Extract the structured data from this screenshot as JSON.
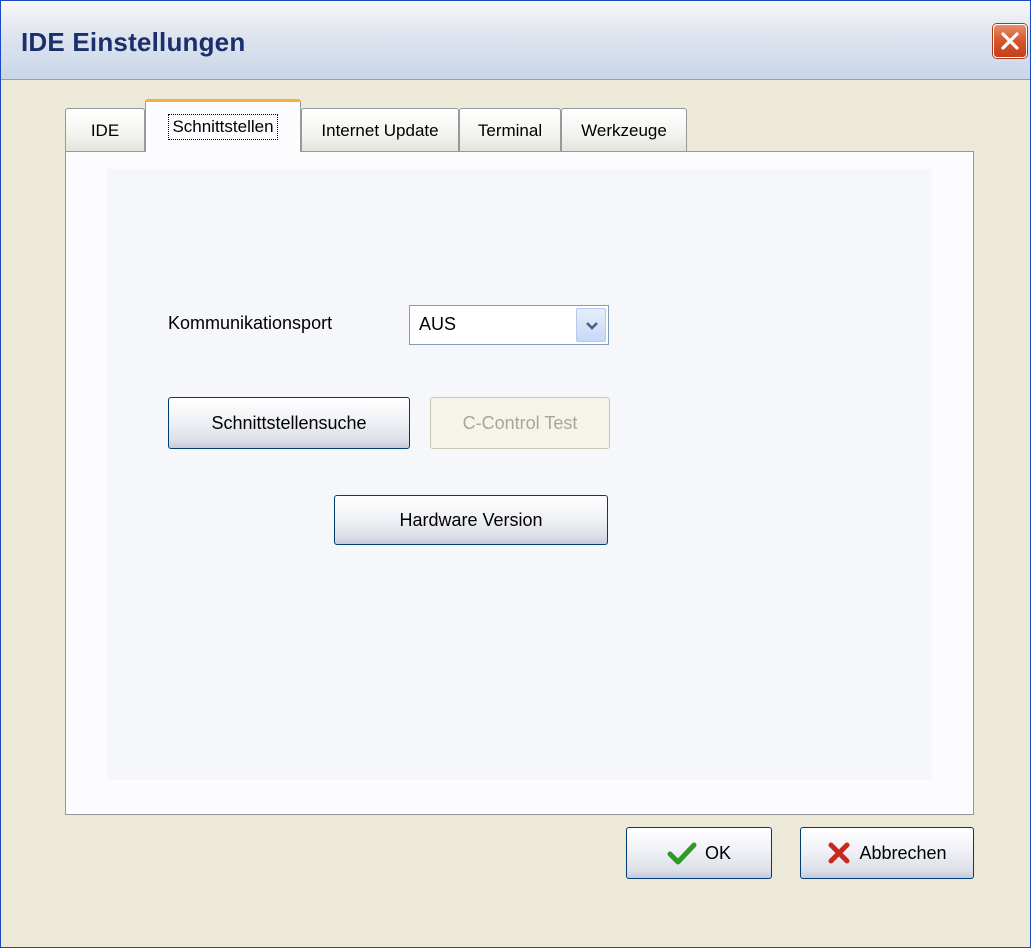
{
  "window": {
    "title": "IDE Einstellungen",
    "close_icon": "close-icon"
  },
  "tabs": [
    {
      "label": "IDE",
      "active": false
    },
    {
      "label": "Schnittstellen",
      "active": true
    },
    {
      "label": "Internet Update",
      "active": false
    },
    {
      "label": "Terminal",
      "active": false
    },
    {
      "label": "Werkzeuge",
      "active": false
    }
  ],
  "schnittstellen": {
    "port_label": "Kommunikationsport",
    "port_value": "AUS",
    "search_button": "Schnittstellensuche",
    "test_button": "C-Control Test",
    "test_button_enabled": false,
    "hardware_button": "Hardware Version"
  },
  "footer": {
    "ok_label": "OK",
    "ok_icon": "checkmark-icon",
    "cancel_label": "Abbrechen",
    "cancel_icon": "cross-icon"
  },
  "colors": {
    "window_bg": "#ece9d8",
    "active_tab_highlight": "#f5b040",
    "checkmark": "#2f9a24",
    "cross": "#c8281e"
  }
}
